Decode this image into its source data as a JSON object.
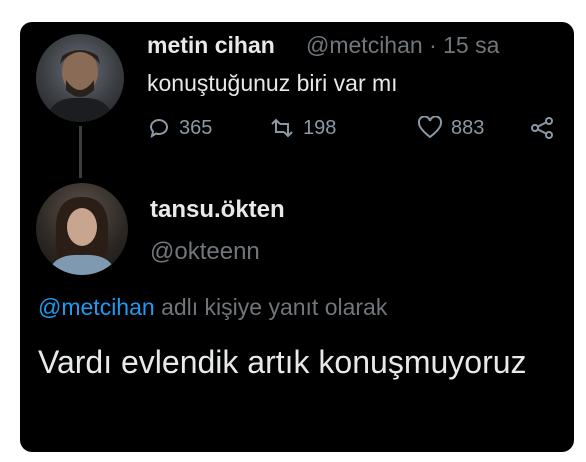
{
  "tweet1": {
    "display_name": "metin cihan",
    "meta": "@metcihan · 15 sa",
    "text": "konuştuğunuz biri var mı",
    "stats": {
      "replies": "365",
      "retweets": "198",
      "likes": "883"
    }
  },
  "tweet2": {
    "display_name": "tansu.ökten",
    "handle": "@okteenn",
    "reply_mention": "@metcihan",
    "reply_suffix": " adlı kişiye yanıt olarak",
    "text": "Vardı evlendik artık konuşmuyoruz"
  },
  "colors": {
    "background": "#000000",
    "text_primary": "#e7e9ea",
    "text_secondary": "#71767b",
    "link": "#1d9bf0"
  },
  "icons": [
    "reply-icon",
    "retweet-icon",
    "like-icon",
    "share-icon"
  ]
}
